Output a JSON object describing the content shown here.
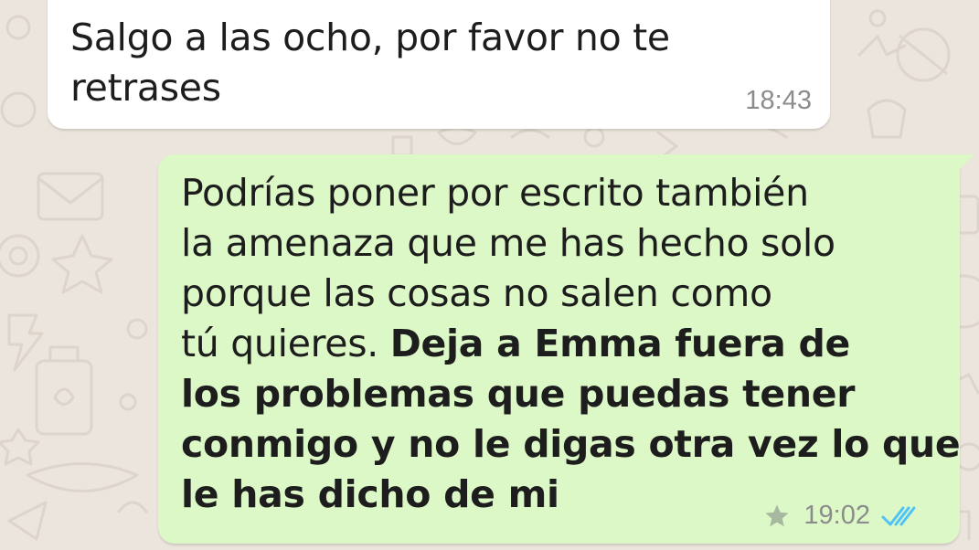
{
  "chat": {
    "wallpaper_color": "#ece5dd",
    "incoming_color": "#ffffff",
    "outgoing_color": "#dcf8c6",
    "messages": [
      {
        "direction": "incoming",
        "lines": [
          "Salgo a las ocho, por favor no te",
          "retrases"
        ],
        "time": "18:43"
      },
      {
        "direction": "outgoing",
        "lines": [
          "Podrías poner por escrito también",
          "la amenaza que me has hecho solo",
          "porque las cosas no salen como",
          "tú quieres. ",
          "Deja a Emma fuera de",
          "los problemas que puedas tener",
          "conmigo y no le digas otra vez lo que",
          "le has dicho de mi"
        ],
        "time": "19:02",
        "starred": true,
        "status_icon": "double-check-icon",
        "status_color": "#4fc3f7",
        "star_color": "#a6b8a0"
      }
    ]
  }
}
